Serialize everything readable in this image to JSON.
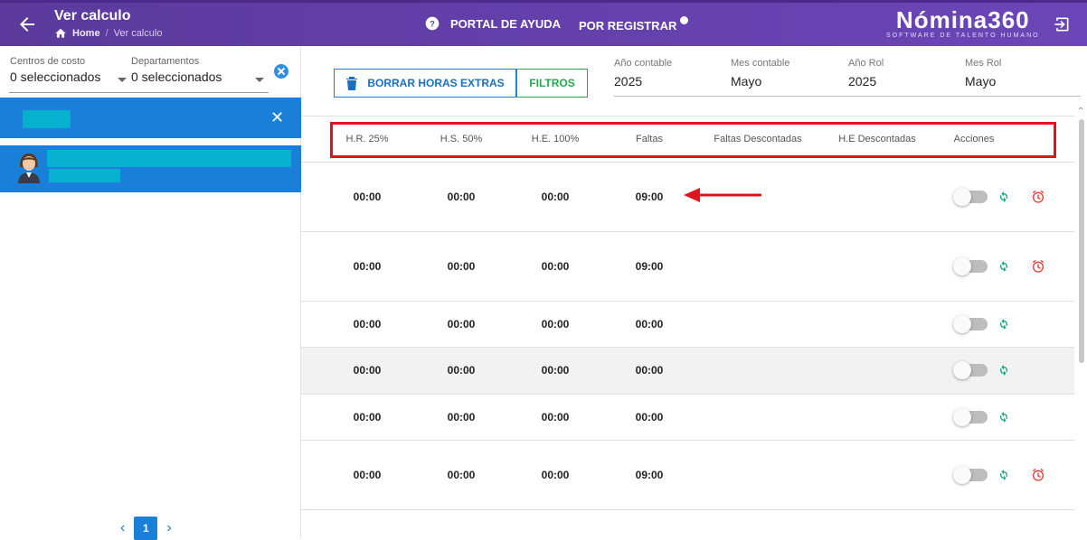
{
  "header": {
    "title": "Ver calculo",
    "breadcrumb_home": "Home",
    "breadcrumb_sep": "/",
    "breadcrumb_current": "Ver calculo",
    "help_label": "PORTAL DE AYUDA",
    "register_label": "POR REGISTRAR",
    "brand_name": "Nómina360",
    "brand_tagline": "SOFTWARE DE TALENTO HUMANO",
    "accent_color": "#6b46b8"
  },
  "filters": {
    "cost_centers_label": "Centros de costo",
    "cost_centers_value": "0 seleccionados",
    "departments_label": "Departamentos",
    "departments_value": "0 seleccionados"
  },
  "sidebar": {
    "close_label": "✕",
    "pagination": {
      "prev": "‹",
      "current_page": "1",
      "next": "›"
    }
  },
  "toolbar": {
    "delete_label": "BORRAR HORAS EXTRAS",
    "filters_label": "FILTROS"
  },
  "period": {
    "fields": [
      {
        "label": "Año contable",
        "value": "2025"
      },
      {
        "label": "Mes contable",
        "value": "Mayo"
      },
      {
        "label": "Año Rol",
        "value": "2025"
      },
      {
        "label": "Mes Rol",
        "value": "Mayo"
      }
    ]
  },
  "table": {
    "columns": [
      "H.R. 25%",
      "H.S. 50%",
      "H.E. 100%",
      "Faltas",
      "Faltas Descontadas",
      "H.E Descontadas",
      "Acciones"
    ],
    "rows": [
      {
        "hr25": "00:00",
        "hs50": "00:00",
        "he100": "00:00",
        "faltas": "09:00",
        "has_clock": true
      },
      {
        "hr25": "00:00",
        "hs50": "00:00",
        "he100": "00:00",
        "faltas": "09:00",
        "has_clock": true
      },
      {
        "hr25": "00:00",
        "hs50": "00:00",
        "he100": "00:00",
        "faltas": "00:00",
        "has_clock": false
      },
      {
        "hr25": "00:00",
        "hs50": "00:00",
        "he100": "00:00",
        "faltas": "00:00",
        "has_clock": false
      },
      {
        "hr25": "00:00",
        "hs50": "00:00",
        "he100": "00:00",
        "faltas": "00:00",
        "has_clock": false
      },
      {
        "hr25": "00:00",
        "hs50": "00:00",
        "he100": "00:00",
        "faltas": "09:00",
        "has_clock": true
      }
    ]
  },
  "colors": {
    "primary_blue": "#1a7fd8",
    "green": "#22a94f",
    "highlight_red": "#e0151c",
    "refresh_teal": "#1fa88a",
    "clock_red": "#e53935"
  }
}
